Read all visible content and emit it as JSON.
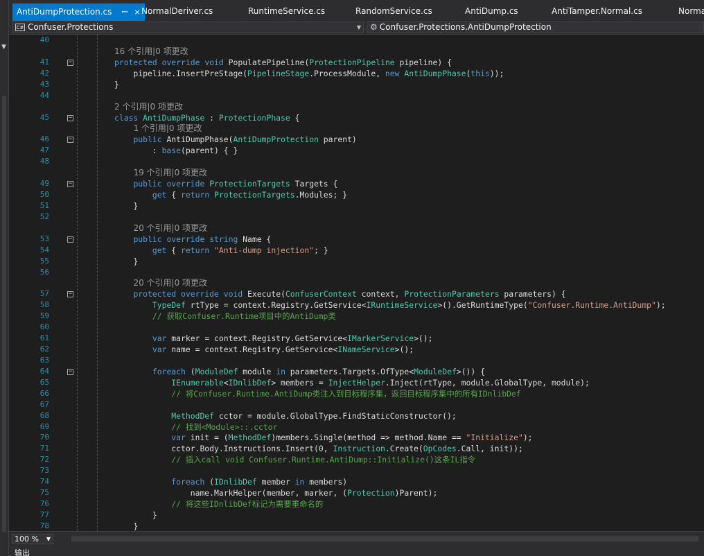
{
  "tabs": [
    {
      "label": "AntiDumpProtection.cs",
      "pin": "ꟷ",
      "close": "×",
      "active": true
    },
    {
      "label": "NormalDeriver.cs"
    },
    {
      "label": "RuntimeService.cs"
    },
    {
      "label": "RandomService.cs"
    },
    {
      "label": "AntiDump.cs"
    },
    {
      "label": "AntiTamper.Normal.cs"
    },
    {
      "label": "Norma"
    }
  ],
  "nav": {
    "project_icon": "C#",
    "project": "Confuser.Protections",
    "member": "Confuser.Protections.AntiDumpProtection"
  },
  "status": {
    "zoom": "100 %",
    "output_label": "输出"
  },
  "icons": {
    "project": "csharp-project-icon",
    "member": "class-member-icon",
    "dropdown": "chevron-down-icon"
  },
  "colors": {
    "accent": "#007acc",
    "keyword": "#569cd6",
    "type": "#4ec9b0",
    "string": "#d69d85",
    "comment": "#57a64a",
    "line_number": "#2b91af"
  },
  "code_lines": [
    {
      "n": "40",
      "segs": []
    },
    {
      "n": "",
      "segs": [
        [
          "l",
          "16 个引用|0 项更改"
        ]
      ]
    },
    {
      "n": "41",
      "fold": true,
      "segs": [
        [
          "k",
          "protected"
        ],
        [
          "p",
          " "
        ],
        [
          "k",
          "override"
        ],
        [
          "p",
          " "
        ],
        [
          "k",
          "void"
        ],
        [
          "p",
          " PopulatePipeline("
        ],
        [
          "t",
          "ProtectionPipeline"
        ],
        [
          "p",
          " pipeline) {"
        ]
      ]
    },
    {
      "n": "42",
      "segs": [
        [
          "p",
          "    pipeline.InsertPreStage("
        ],
        [
          "t",
          "PipelineStage"
        ],
        [
          "p",
          ".ProcessModule, "
        ],
        [
          "k",
          "new"
        ],
        [
          "p",
          " "
        ],
        [
          "t",
          "AntiDumpPhase"
        ],
        [
          "p",
          "("
        ],
        [
          "k",
          "this"
        ],
        [
          "p",
          "));"
        ]
      ]
    },
    {
      "n": "43",
      "segs": [
        [
          "p",
          "}"
        ]
      ]
    },
    {
      "n": "44",
      "segs": []
    },
    {
      "n": "",
      "segs": [
        [
          "l",
          "2 个引用|0 项更改"
        ]
      ]
    },
    {
      "n": "45",
      "fold": true,
      "segs": [
        [
          "k",
          "class"
        ],
        [
          "p",
          " "
        ],
        [
          "t",
          "AntiDumpPhase"
        ],
        [
          "p",
          " : "
        ],
        [
          "t",
          "ProtectionPhase"
        ],
        [
          "p",
          " {"
        ]
      ]
    },
    {
      "n": "",
      "segs": [
        [
          "p",
          "    "
        ],
        [
          "l",
          "1 个引用|0 项更改"
        ]
      ]
    },
    {
      "n": "46",
      "fold": true,
      "segs": [
        [
          "p",
          "    "
        ],
        [
          "k",
          "public"
        ],
        [
          "p",
          " AntiDumpPhase("
        ],
        [
          "t",
          "AntiDumpProtection"
        ],
        [
          "p",
          " parent)"
        ]
      ]
    },
    {
      "n": "47",
      "segs": [
        [
          "p",
          "        : "
        ],
        [
          "k",
          "base"
        ],
        [
          "p",
          "(parent) { }"
        ]
      ]
    },
    {
      "n": "48",
      "segs": []
    },
    {
      "n": "",
      "segs": [
        [
          "p",
          "    "
        ],
        [
          "l",
          "19 个引用|0 项更改"
        ]
      ]
    },
    {
      "n": "49",
      "fold": true,
      "segs": [
        [
          "p",
          "    "
        ],
        [
          "k",
          "public"
        ],
        [
          "p",
          " "
        ],
        [
          "k",
          "override"
        ],
        [
          "p",
          " "
        ],
        [
          "t",
          "ProtectionTargets"
        ],
        [
          "p",
          " Targets {"
        ]
      ]
    },
    {
      "n": "50",
      "segs": [
        [
          "p",
          "        "
        ],
        [
          "k",
          "get"
        ],
        [
          "p",
          " { "
        ],
        [
          "k",
          "return"
        ],
        [
          "p",
          " "
        ],
        [
          "t",
          "ProtectionTargets"
        ],
        [
          "p",
          ".Modules; }"
        ]
      ]
    },
    {
      "n": "51",
      "segs": [
        [
          "p",
          "    }"
        ]
      ]
    },
    {
      "n": "52",
      "segs": []
    },
    {
      "n": "",
      "segs": [
        [
          "p",
          "    "
        ],
        [
          "l",
          "20 个引用|0 项更改"
        ]
      ]
    },
    {
      "n": "53",
      "fold": true,
      "segs": [
        [
          "p",
          "    "
        ],
        [
          "k",
          "public"
        ],
        [
          "p",
          " "
        ],
        [
          "k",
          "override"
        ],
        [
          "p",
          " "
        ],
        [
          "k",
          "string"
        ],
        [
          "p",
          " Name {"
        ]
      ]
    },
    {
      "n": "54",
      "segs": [
        [
          "p",
          "        "
        ],
        [
          "k",
          "get"
        ],
        [
          "p",
          " { "
        ],
        [
          "k",
          "return"
        ],
        [
          "p",
          " "
        ],
        [
          "s",
          "\"Anti-dump injection\""
        ],
        [
          "p",
          "; }"
        ]
      ]
    },
    {
      "n": "55",
      "segs": [
        [
          "p",
          "    }"
        ]
      ]
    },
    {
      "n": "56",
      "segs": []
    },
    {
      "n": "",
      "segs": [
        [
          "p",
          "    "
        ],
        [
          "l",
          "20 个引用|0 项更改"
        ]
      ]
    },
    {
      "n": "57",
      "fold": true,
      "segs": [
        [
          "p",
          "    "
        ],
        [
          "k",
          "protected"
        ],
        [
          "p",
          " "
        ],
        [
          "k",
          "override"
        ],
        [
          "p",
          " "
        ],
        [
          "k",
          "void"
        ],
        [
          "p",
          " Execute("
        ],
        [
          "t",
          "ConfuserContext"
        ],
        [
          "p",
          " context, "
        ],
        [
          "t",
          "ProtectionParameters"
        ],
        [
          "p",
          " parameters) {"
        ]
      ]
    },
    {
      "n": "58",
      "segs": [
        [
          "p",
          "        "
        ],
        [
          "t",
          "TypeDef"
        ],
        [
          "p",
          " rtType = context.Registry.GetService<"
        ],
        [
          "t",
          "IRuntimeService"
        ],
        [
          "p",
          ">().GetRuntimeType("
        ],
        [
          "s",
          "\"Confuser.Runtime.AntiDump\""
        ],
        [
          "p",
          ");"
        ]
      ]
    },
    {
      "n": "59",
      "segs": [
        [
          "p",
          "        "
        ],
        [
          "c",
          "// 获取Confuser.Runtime项目中的AntiDump类"
        ]
      ]
    },
    {
      "n": "60",
      "segs": []
    },
    {
      "n": "61",
      "segs": [
        [
          "p",
          "        "
        ],
        [
          "k",
          "var"
        ],
        [
          "p",
          " marker = context.Registry.GetService<"
        ],
        [
          "t",
          "IMarkerService"
        ],
        [
          "p",
          ">();"
        ]
      ]
    },
    {
      "n": "62",
      "segs": [
        [
          "p",
          "        "
        ],
        [
          "k",
          "var"
        ],
        [
          "p",
          " name = context.Registry.GetService<"
        ],
        [
          "t",
          "INameService"
        ],
        [
          "p",
          ">();"
        ]
      ]
    },
    {
      "n": "63",
      "segs": []
    },
    {
      "n": "64",
      "fold": true,
      "segs": [
        [
          "p",
          "        "
        ],
        [
          "k",
          "foreach"
        ],
        [
          "p",
          " ("
        ],
        [
          "t",
          "ModuleDef"
        ],
        [
          "p",
          " module "
        ],
        [
          "k",
          "in"
        ],
        [
          "p",
          " parameters.Targets.OfType<"
        ],
        [
          "t",
          "ModuleDef"
        ],
        [
          "p",
          ">()) {"
        ]
      ]
    },
    {
      "n": "65",
      "segs": [
        [
          "p",
          "            "
        ],
        [
          "t",
          "IEnumerable"
        ],
        [
          "p",
          "<"
        ],
        [
          "t",
          "IDnlibDef"
        ],
        [
          "p",
          "> members = "
        ],
        [
          "t",
          "InjectHelper"
        ],
        [
          "p",
          ".Inject(rtType, module.GlobalType, module);"
        ]
      ]
    },
    {
      "n": "66",
      "segs": [
        [
          "p",
          "            "
        ],
        [
          "c",
          "// 将Confuser.Runtime.AntiDump类注入到目标程序集，返回目标程序集中的所有IDnlibDef"
        ]
      ]
    },
    {
      "n": "67",
      "segs": []
    },
    {
      "n": "68",
      "segs": [
        [
          "p",
          "            "
        ],
        [
          "t",
          "MethodDef"
        ],
        [
          "p",
          " cctor = module.GlobalType.FindStaticConstructor();"
        ]
      ]
    },
    {
      "n": "69",
      "segs": [
        [
          "p",
          "            "
        ],
        [
          "c",
          "// 找到<Module>::.cctor"
        ]
      ]
    },
    {
      "n": "70",
      "segs": [
        [
          "p",
          "            "
        ],
        [
          "k",
          "var"
        ],
        [
          "p",
          " init = ("
        ],
        [
          "t",
          "MethodDef"
        ],
        [
          "p",
          ")members.Single(method => method.Name == "
        ],
        [
          "s",
          "\"Initialize\""
        ],
        [
          "p",
          ");"
        ]
      ]
    },
    {
      "n": "71",
      "segs": [
        [
          "p",
          "            cctor.Body.Instructions.Insert(0, "
        ],
        [
          "t",
          "Instruction"
        ],
        [
          "p",
          ".Create("
        ],
        [
          "t",
          "OpCodes"
        ],
        [
          "p",
          ".Call, init));"
        ]
      ]
    },
    {
      "n": "72",
      "segs": [
        [
          "p",
          "            "
        ],
        [
          "c",
          "// 插入call void Confuser.Runtime.AntiDump::Initialize()这条IL指令"
        ]
      ]
    },
    {
      "n": "73",
      "segs": []
    },
    {
      "n": "74",
      "segs": [
        [
          "p",
          "            "
        ],
        [
          "k",
          "foreach"
        ],
        [
          "p",
          " ("
        ],
        [
          "t",
          "IDnlibDef"
        ],
        [
          "p",
          " member "
        ],
        [
          "k",
          "in"
        ],
        [
          "p",
          " members)"
        ]
      ]
    },
    {
      "n": "75",
      "segs": [
        [
          "p",
          "                name.MarkHelper(member, marker, ("
        ],
        [
          "t",
          "Protection"
        ],
        [
          "p",
          ")Parent);"
        ]
      ]
    },
    {
      "n": "76",
      "segs": [
        [
          "p",
          "            "
        ],
        [
          "c",
          "// 将这些IDnlibDef标记为需要重命名的"
        ]
      ]
    },
    {
      "n": "77",
      "segs": [
        [
          "p",
          "        }"
        ]
      ]
    },
    {
      "n": "78",
      "segs": [
        [
          "p",
          "    }"
        ]
      ]
    }
  ]
}
